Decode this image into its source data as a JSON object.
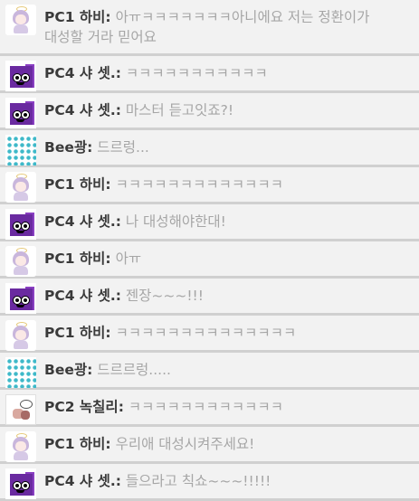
{
  "messages": [
    {
      "avatar": "pc1",
      "speaker": "PC1 하비:",
      "text": "아ㅠㅋㅋㅋㅋㅋㅋㅋ아니에요 저는 정환이가 대성할 거라 믿어요"
    },
    {
      "avatar": "pc4",
      "speaker": "PC4 샤 셋.:",
      "text": "ㅋㅋㅋㅋㅋㅋㅋㅋㅋㅋㅋ"
    },
    {
      "avatar": "pc4",
      "speaker": "PC4 샤 셋.:",
      "text": "마스터 듣고잇죠?!"
    },
    {
      "avatar": "bee",
      "speaker": "Bee광:",
      "text": "드르렁..."
    },
    {
      "avatar": "pc1",
      "speaker": "PC1 하비:",
      "text": "ㅋㅋㅋㅋㅋㅋㅋㅋㅋㅋㅋㅋㅋ"
    },
    {
      "avatar": "pc4",
      "speaker": "PC4 샤 셋.:",
      "text": "나 대성해야한대!"
    },
    {
      "avatar": "pc1",
      "speaker": "PC1 하비:",
      "text": "아ㅠ"
    },
    {
      "avatar": "pc4",
      "speaker": "PC4 샤 셋.:",
      "text": "젠장~~~!!!"
    },
    {
      "avatar": "pc1",
      "speaker": "PC1 하비:",
      "text": "ㅋㅋㅋㅋㅋㅋㅋㅋㅋㅋㅋㅋㅋㅋ"
    },
    {
      "avatar": "bee",
      "speaker": "Bee광:",
      "text": "드르르렁....."
    },
    {
      "avatar": "pc2",
      "speaker": "PC2 녹칠리:",
      "text": "ㅋㅋㅋㅋㅋㅋㅋㅋㅋㅋㅋㅋ"
    },
    {
      "avatar": "pc1",
      "speaker": "PC1 하비:",
      "text": "우리애 대성시켜주세요!"
    },
    {
      "avatar": "pc4",
      "speaker": "PC4 샤 셋.:",
      "text": "들으라고 칙쇼~~~!!!!!"
    }
  ]
}
